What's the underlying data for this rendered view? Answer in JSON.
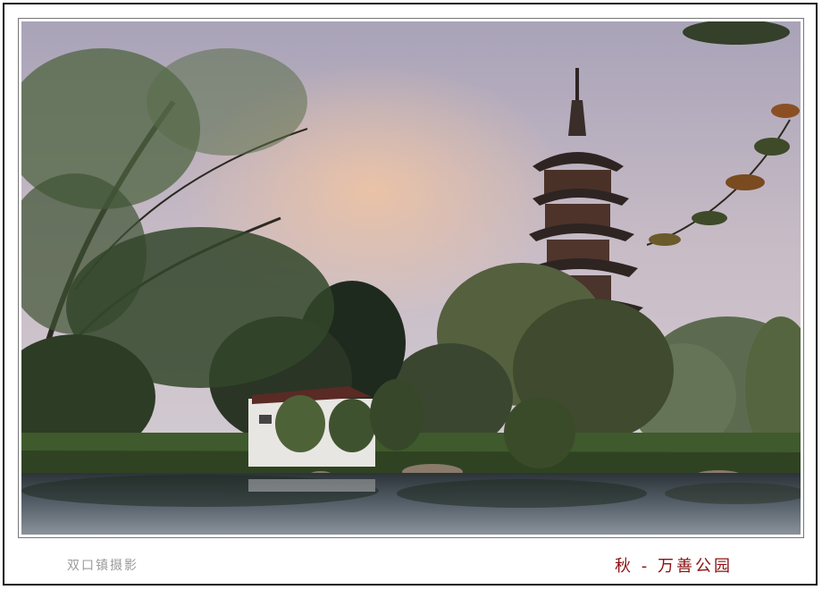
{
  "photographer_credit": "双口镇摄影",
  "photo_title": "秋 - 万善公园",
  "colors": {
    "title_text": "#8b1010",
    "credit_text": "#9a9a9a",
    "sky_top": "#b8b0c4",
    "sky_glow": "#e8c2a8",
    "water": "#3c4a55"
  }
}
